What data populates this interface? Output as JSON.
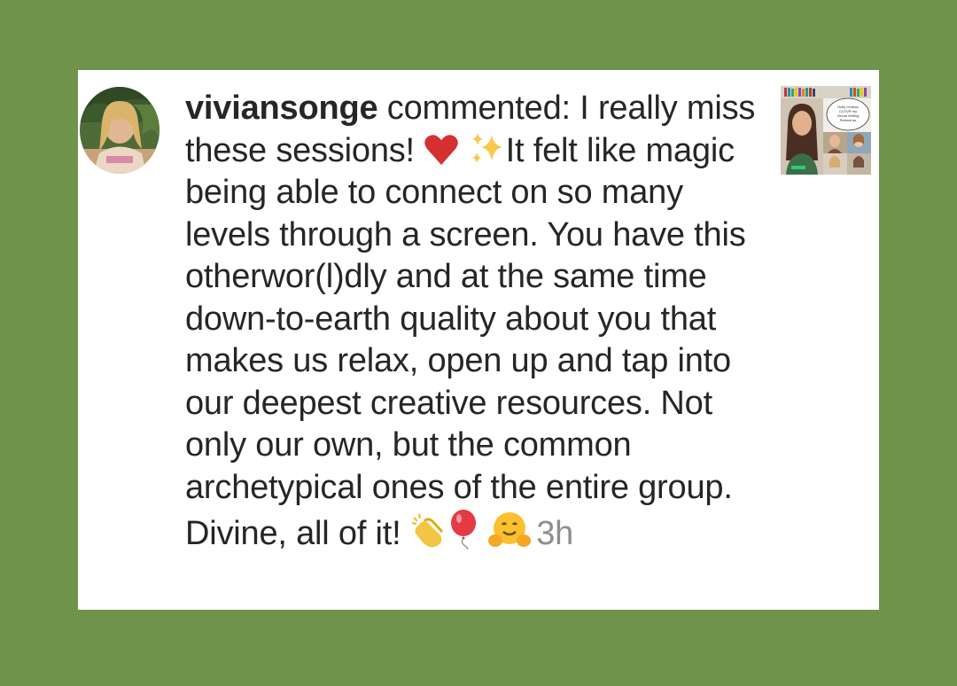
{
  "comment": {
    "username": "viviansonge",
    "text_1": " commented: I really miss these sessions! ",
    "text_2": "It felt like magic being able to connect on so many levels through a screen. You have this otherwor(l)dly and at the same time down-to-earth quality about you that makes us relax, open up and tap into our deepest creative resources. Not only our own, but the common archetypical ones of the entire group. Divine, all of it! ",
    "timestamp": "3h",
    "emojis_inline": [
      "heart-icon",
      "sparkles-icon"
    ],
    "emojis_end": [
      "clapping-hands-icon",
      "balloon-icon",
      "hugging-face-icon"
    ]
  },
  "thumbnail": {
    "speech_bubble_text": [
      "Holly reviews",
      "CLOVR my",
      "Virtual Writing",
      "Retreat as"
    ]
  },
  "colors": {
    "background": "#6f934a",
    "card": "#ffffff",
    "text": "#262626",
    "timestamp": "#8e8e8e",
    "heart": "#d62f2f"
  }
}
